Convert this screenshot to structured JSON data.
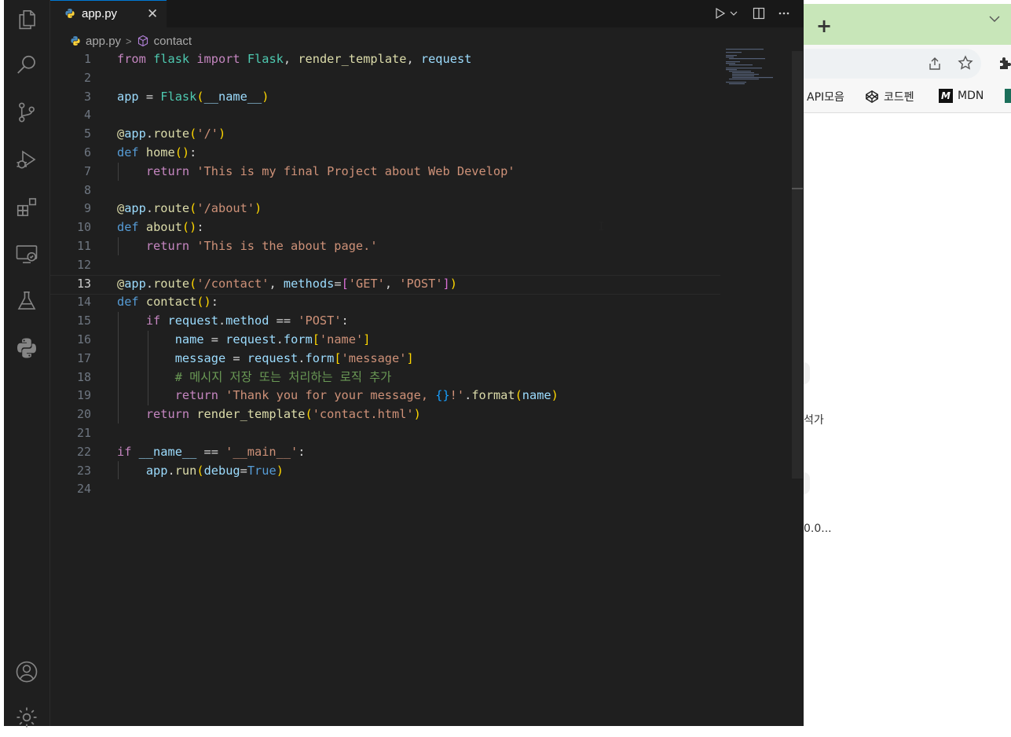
{
  "editor": {
    "tab_label": "app.py",
    "close_glyph": "✕",
    "breadcrumb": {
      "file": "app.py",
      "symbol": "contact"
    },
    "active_line": 13,
    "line_numbers": [
      "1",
      "2",
      "3",
      "4",
      "5",
      "6",
      "7",
      "8",
      "9",
      "10",
      "11",
      "12",
      "13",
      "14",
      "15",
      "16",
      "17",
      "18",
      "19",
      "20",
      "21",
      "22",
      "23",
      "24"
    ],
    "code_lines": [
      "from flask import Flask, render_template, request",
      "",
      "app = Flask(__name__)",
      "",
      "@app.route('/')",
      "def home():",
      "    return 'This is my final Project about Web Develop'",
      "",
      "@app.route('/about')",
      "def about():",
      "    return 'This is the about page.'",
      "",
      "@app.route('/contact', methods=['GET', 'POST'])",
      "def contact():",
      "    if request.method == 'POST':",
      "        name = request.form['name']",
      "        message = request.form['message']",
      "        # 메시지 저장 또는 처리하는 로직 추가",
      "        return 'Thank you for your message, {}!'.format(name)",
      "    return render_template('contact.html')",
      "",
      "if __name__ == '__main__':",
      "    app.run(debug=True)",
      ""
    ]
  },
  "activity_bar": {
    "top_icons": [
      "explorer-icon",
      "search-icon",
      "source-control-icon",
      "run-debug-icon",
      "extensions-icon",
      "remote-explorer-icon",
      "testing-icon",
      "python-icon"
    ],
    "bottom_icons": [
      "account-icon",
      "settings-gear-icon"
    ]
  },
  "browser": {
    "new_tab_glyph": "+",
    "bookmarks": [
      {
        "label": "API모음"
      },
      {
        "label": "코드펜"
      },
      {
        "label": "MDN",
        "badge": "M"
      }
    ],
    "fragment_1": "석가",
    "fragment_2": "0.0..."
  },
  "colors": {
    "editor_bg": "#1f1f1f",
    "tab_accent": "#0078d4",
    "browser_tab_bg": "#c8e6b9"
  }
}
